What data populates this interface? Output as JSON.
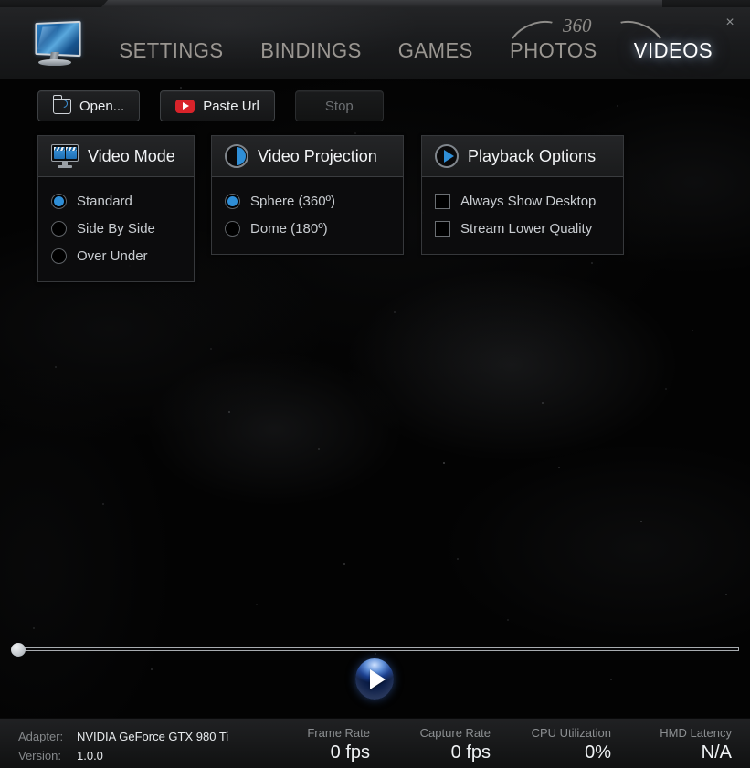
{
  "window": {
    "close_label": "×"
  },
  "header": {
    "logo_icon": "monitor-icon",
    "badge_360": "360",
    "tabs": [
      {
        "label": "SETTINGS",
        "active": false
      },
      {
        "label": "BINDINGS",
        "active": false
      },
      {
        "label": "GAMES",
        "active": false
      },
      {
        "label": "PHOTOS",
        "active": false
      },
      {
        "label": "VIDEOS",
        "active": true
      }
    ]
  },
  "toolbar": {
    "open_label": "Open...",
    "open_icon": "folder-open-icon",
    "paste_url_label": "Paste Url",
    "paste_url_icon": "youtube-icon",
    "stop_label": "Stop",
    "stop_disabled": true
  },
  "panels": {
    "video_mode": {
      "title": "Video Mode",
      "icon": "video-mode-monitor-icon",
      "options": [
        {
          "label": "Standard",
          "selected": true
        },
        {
          "label": "Side By Side",
          "selected": false
        },
        {
          "label": "Over Under",
          "selected": false
        }
      ]
    },
    "video_projection": {
      "title": "Video Projection",
      "icon": "half-sphere-icon",
      "options": [
        {
          "label": "Sphere (360º)",
          "selected": true
        },
        {
          "label": "Dome (180º)",
          "selected": false
        }
      ]
    },
    "playback_options": {
      "title": "Playback Options",
      "icon": "play-circle-icon",
      "options": [
        {
          "label": "Always Show Desktop",
          "checked": false
        },
        {
          "label": "Stream Lower Quality",
          "checked": false
        }
      ]
    }
  },
  "player": {
    "seek_position_percent": 0,
    "play_icon": "play-button-icon"
  },
  "status": {
    "adapter_label": "Adapter:",
    "adapter_value": "NVIDIA GeForce GTX 980 Ti",
    "version_label": "Version:",
    "version_value": "1.0.0",
    "stats": [
      {
        "label": "Frame Rate",
        "value": "0 fps"
      },
      {
        "label": "Capture Rate",
        "value": "0 fps"
      },
      {
        "label": "CPU Utilization",
        "value": "0%"
      },
      {
        "label": "HMD Latency",
        "value": "N/A"
      }
    ]
  },
  "colors": {
    "accent_blue": "#2f8ed6",
    "youtube_red": "#d8232a",
    "active_tab": "#ffffff",
    "inactive_tab": "#9a9691"
  }
}
